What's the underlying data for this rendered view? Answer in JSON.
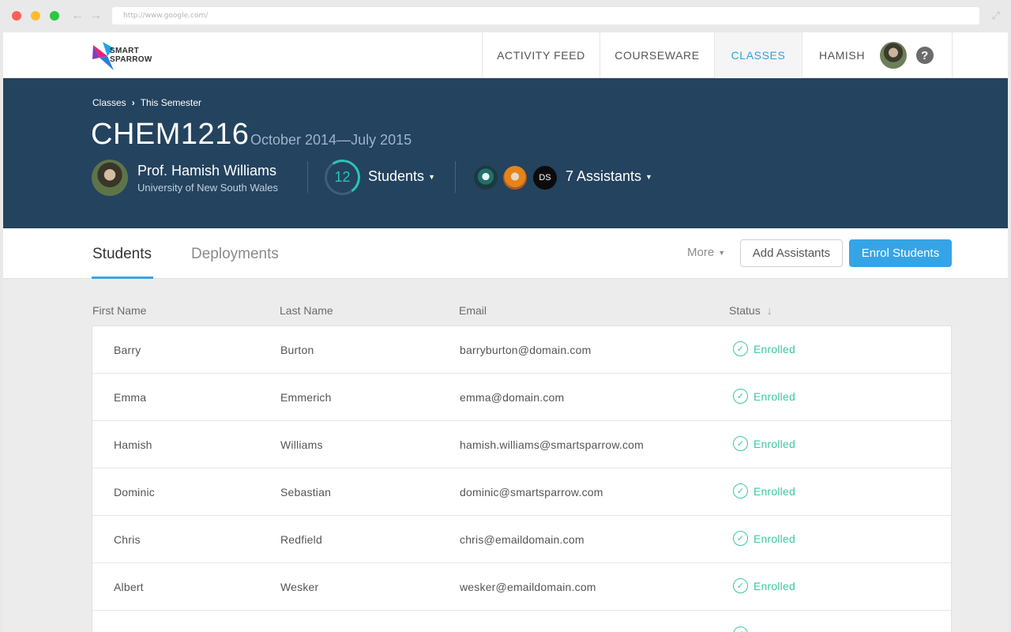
{
  "browser": {
    "url": "http://www.google.com/",
    "back_icon": "arrow-left-icon",
    "forward_icon": "arrow-right-icon",
    "expand_icon": "expand-icon"
  },
  "logo": {
    "line1": "SMART",
    "line2": "SPARROW"
  },
  "nav": {
    "items": [
      {
        "label": "ACTIVITY FEED"
      },
      {
        "label": "COURSEWARE"
      },
      {
        "label": "CLASSES",
        "active": true
      }
    ],
    "user": "HAMISH",
    "help": "?"
  },
  "hero": {
    "breadcrumb": {
      "root": "Classes",
      "current": "This Semester"
    },
    "title": "CHEM1216",
    "dates": "October 2014—July 2015",
    "professor": {
      "name": "Prof. Hamish Williams",
      "university": "University of New South Wales"
    },
    "student_count": "12",
    "students_label": "Students",
    "assistant_initials": "DS",
    "assistants_label": "7 Assistants"
  },
  "tabs": {
    "students": "Students",
    "deployments": "Deployments",
    "more": "More",
    "add_assistants": "Add Assistants",
    "enrol_students": "Enrol Students"
  },
  "table": {
    "headers": {
      "first": "First Name",
      "last": "Last Name",
      "email": "Email",
      "status": "Status"
    },
    "rows": [
      {
        "first": "Barry",
        "last": "Burton",
        "email": "barryburton@domain.com",
        "status": "Enrolled"
      },
      {
        "first": "Emma",
        "last": "Emmerich",
        "email": "emma@domain.com",
        "status": "Enrolled"
      },
      {
        "first": "Hamish",
        "last": "Williams",
        "email": "hamish.williams@smartsparrow.com",
        "status": "Enrolled"
      },
      {
        "first": "Dominic",
        "last": "Sebastian",
        "email": "dominic@smartsparrow.com",
        "status": "Enrolled"
      },
      {
        "first": "Chris",
        "last": "Redfield",
        "email": "chris@emaildomain.com",
        "status": "Enrolled"
      },
      {
        "first": "Albert",
        "last": "Wesker",
        "email": "wesker@emaildomain.com",
        "status": "Enrolled"
      }
    ]
  },
  "colors": {
    "accent": "#35a4e6",
    "hero_bg": "#23435f",
    "enrolled": "#3cc8a0",
    "ring": "#29c5b9"
  }
}
